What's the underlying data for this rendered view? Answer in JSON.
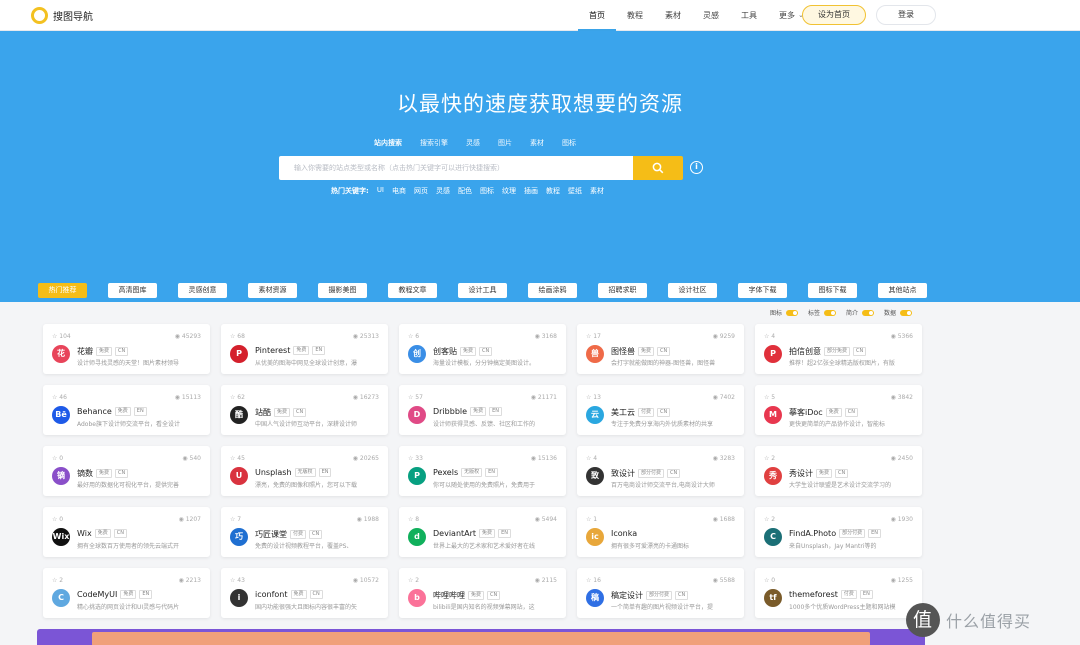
{
  "logo_text": "搜图导航",
  "nav": [
    {
      "label": "首页",
      "active": true
    },
    {
      "label": "教程"
    },
    {
      "label": "素材"
    },
    {
      "label": "灵感"
    },
    {
      "label": "工具"
    },
    {
      "label": "更多",
      "dropdown": true
    }
  ],
  "set_home": "设为首页",
  "login": "登录",
  "hero": {
    "title": "以最快的速度获取想要的资源",
    "tabs": [
      "站内搜索",
      "搜索引擎",
      "灵感",
      "图片",
      "素材",
      "图标"
    ],
    "placeholder": "输入你需要的站点类型或名称（点击热门关键字可以进行快捷搜索）",
    "hot_label": "热门关键字:",
    "hot_words": [
      "UI",
      "电商",
      "网页",
      "灵感",
      "配色",
      "图标",
      "纹理",
      "插画",
      "教程",
      "壁纸",
      "素材"
    ]
  },
  "categories": [
    "热门推荐",
    "高清图库",
    "灵感创意",
    "素材资源",
    "摄影美图",
    "教程文章",
    "设计工具",
    "绘画涂鸦",
    "招聘求职",
    "设计社区",
    "字体下载",
    "图标下载",
    "其他站点"
  ],
  "toggles": [
    "图标",
    "标签",
    "简介",
    "数据"
  ],
  "cards": [
    {
      "star": "104",
      "views": "45293",
      "name": "花瓣",
      "tags": [
        "免费",
        "CN"
      ],
      "desc": "设计师寻找灵感的天堂！图片素材领导",
      "icon": "花",
      "color": "#e8445a"
    },
    {
      "star": "68",
      "views": "25313",
      "name": "Pinterest",
      "tags": [
        "免费",
        "EN"
      ],
      "desc": "从优美的图海中网见全球设计创意，瀑",
      "icon": "P",
      "color": "#d4202c"
    },
    {
      "star": "6",
      "views": "3168",
      "name": "创客贴",
      "tags": [
        "免费",
        "CN"
      ],
      "desc": "海量设计模板，分分钟搞定美图设计。",
      "icon": "创",
      "color": "#3a8ee6"
    },
    {
      "star": "17",
      "views": "9259",
      "name": "图怪兽",
      "tags": [
        "免费",
        "CN"
      ],
      "desc": "会打字就能做图的神器-图怪兽，图怪兽",
      "icon": "兽",
      "color": "#ef6a48"
    },
    {
      "star": "4",
      "views": "5366",
      "name": "拍信创意",
      "tags": [
        "部分免费",
        "CN"
      ],
      "desc": "推荐！超2亿张全球精选版权图片，有版",
      "icon": "P",
      "color": "#e0303b"
    },
    {
      "star": "46",
      "views": "15113",
      "name": "Behance",
      "tags": [
        "免费",
        "EN"
      ],
      "desc": "Adobe旗下设计师交流平台，看全设计",
      "icon": "Bē",
      "color": "#1e5ae8"
    },
    {
      "star": "62",
      "views": "16273",
      "name": "站酷",
      "tags": [
        "免费",
        "CN"
      ],
      "desc": "中国人气设计师互动平台，深耕设计师",
      "icon": "酷",
      "color": "#222222"
    },
    {
      "star": "57",
      "views": "21171",
      "name": "Dribbble",
      "tags": [
        "免费",
        "EN"
      ],
      "desc": "设计师获得灵感、反馈、社区和工作的",
      "icon": "D",
      "color": "#e04a86"
    },
    {
      "star": "13",
      "views": "7402",
      "name": "美工云",
      "tags": [
        "付费",
        "CN"
      ],
      "desc": "专注于免费分享海内外优质素材的共享",
      "icon": "云",
      "color": "#2aa7e0"
    },
    {
      "star": "5",
      "views": "3842",
      "name": "摹客iDoc",
      "tags": [
        "免费",
        "CN"
      ],
      "desc": "更快更简单的产品协作设计，智能标",
      "icon": "M",
      "color": "#e8374f"
    },
    {
      "star": "0",
      "views": "540",
      "name": "镝数",
      "tags": [
        "免费",
        "CN"
      ],
      "desc": "最好用的数据化可视化平台，提供完善",
      "icon": "镝",
      "color": "#8a4fc9"
    },
    {
      "star": "45",
      "views": "20265",
      "name": "Unsplash",
      "tags": [
        "无版权",
        "EN"
      ],
      "desc": "漂亮，免费的图像和照片，您可以下载",
      "icon": "U",
      "color": "#d9333f"
    },
    {
      "star": "33",
      "views": "15136",
      "name": "Pexels",
      "tags": [
        "无版权",
        "EN"
      ],
      "desc": "你可以随处使用的免费照片，免费用于",
      "icon": "P",
      "color": "#07a081"
    },
    {
      "star": "4",
      "views": "3283",
      "name": "致设计",
      "tags": [
        "部分付费",
        "CN"
      ],
      "desc": "百万电商设计师交流平台,电商设计大师",
      "icon": "致",
      "color": "#333333"
    },
    {
      "star": "2",
      "views": "2450",
      "name": "秀设计",
      "tags": [
        "免费",
        "CN"
      ],
      "desc": "大学生设计联盟是艺术设计交流学习的",
      "icon": "秀",
      "color": "#e04040"
    },
    {
      "star": "0",
      "views": "1207",
      "name": "Wix",
      "tags": [
        "免费",
        "CN"
      ],
      "desc": "拥有全球数百万使用者的领先云端式开",
      "icon": "Wix",
      "color": "#111111"
    },
    {
      "star": "7",
      "views": "1988",
      "name": "巧匠课堂",
      "tags": [
        "付费",
        "CN"
      ],
      "desc": "免费的设计视频教程平台，覆盖PS、",
      "icon": "巧",
      "color": "#1f6fd1"
    },
    {
      "star": "8",
      "views": "5494",
      "name": "DeviantArt",
      "tags": [
        "免费",
        "EN"
      ],
      "desc": "世界上最大的艺术家和艺术爱好者在线",
      "icon": "d",
      "color": "#10b05c"
    },
    {
      "star": "1",
      "views": "1688",
      "name": "Iconka",
      "tags": [],
      "desc": "拥有很多可爱漂亮的卡通图标",
      "icon": "ic",
      "color": "#e8a73a"
    },
    {
      "star": "2",
      "views": "1930",
      "name": "FindA.Photo",
      "tags": [
        "部分付费",
        "EN"
      ],
      "desc": "来自Unsplash，Jay Mantri等的",
      "icon": "C",
      "color": "#1b6f76"
    },
    {
      "star": "2",
      "views": "2213",
      "name": "CodeMyUI",
      "tags": [
        "免费",
        "EN"
      ],
      "desc": "精心挑选的网页设计和UI灵感与代码片",
      "icon": "C",
      "color": "#5fa8e0"
    },
    {
      "star": "43",
      "views": "10572",
      "name": "iconfont",
      "tags": [
        "免费",
        "CN"
      ],
      "desc": "国内功能很强大且图标内容很丰富的矢",
      "icon": "i",
      "color": "#333333"
    },
    {
      "star": "2",
      "views": "2115",
      "name": "哔哩哔哩",
      "tags": [
        "免费",
        "CN"
      ],
      "desc": "bilibili是国内知名的视频弹幕网站，这",
      "icon": "b",
      "color": "#fb7299"
    },
    {
      "star": "16",
      "views": "5588",
      "name": "稿定设计",
      "tags": [
        "部分付费",
        "CN"
      ],
      "desc": "一个简单有趣的图片视频设计平台，提",
      "icon": "稿",
      "color": "#2f6fe4"
    },
    {
      "star": "0",
      "views": "1255",
      "name": "themeforest",
      "tags": [
        "付费",
        "EN"
      ],
      "desc": "1000多个优质WordPress主题和网站模",
      "icon": "tf",
      "color": "#7a5b2a"
    }
  ],
  "watermark": "什么值得买",
  "watermark_badge": "值",
  "colors": {
    "hero": "#3aa4ec",
    "accent": "#f5bd17"
  }
}
